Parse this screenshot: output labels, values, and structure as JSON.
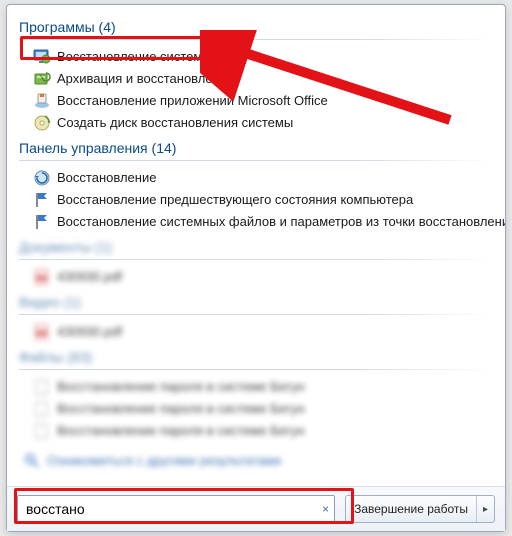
{
  "sections": {
    "programs": {
      "title": "Программы",
      "count": 4
    },
    "control_panel": {
      "title": "Панель управления",
      "count": 14
    },
    "documents": {
      "title": "Документы",
      "count": 1
    },
    "video": {
      "title": "Видео",
      "count": 1
    },
    "files": {
      "title": "Файлы",
      "count": 83
    }
  },
  "programs_items": [
    "Восстановление системы",
    "Архивация и восстановление",
    "Восстановление приложений Microsoft Office",
    "Создать диск восстановления системы"
  ],
  "control_panel_items": [
    "Восстановление",
    "Восстановление предшествующего состояния компьютера",
    "Восстановление системных файлов и параметров из точки восстановления"
  ],
  "blurred_docs": [
    "430930.pdf"
  ],
  "blurred_video": [
    "430930.pdf"
  ],
  "blurred_files": [
    "Восстановление пароля в системе Бегун",
    "Восстановление пароля в системе Бегун",
    "Восстановление пароля в системе Бегун"
  ],
  "more_results_label": "Ознакомиться с другими результатами",
  "search": {
    "value": "восстано",
    "clear": "×"
  },
  "shutdown": {
    "label": "Завершение работы",
    "arrow": "▸"
  }
}
